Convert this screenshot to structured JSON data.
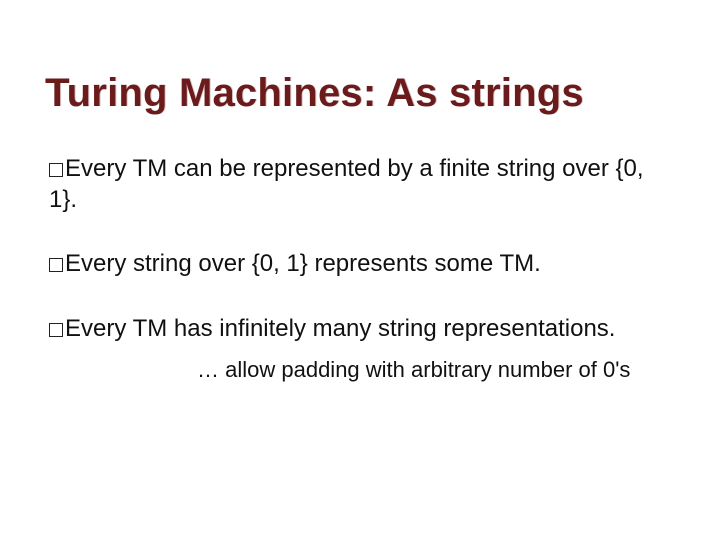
{
  "title": "Turing Machines:  As strings",
  "points": [
    "Every TM can be represented by a finite string over {0, 1}.",
    "Every string over {0, 1} represents some TM.",
    "Every TM has infinitely many string representations."
  ],
  "subpoint": "… allow padding with arbitrary number of 0's"
}
